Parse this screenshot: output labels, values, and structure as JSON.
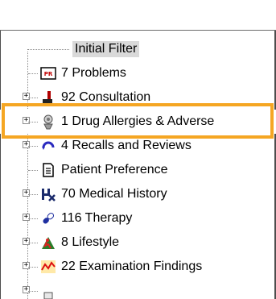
{
  "tree": {
    "root_label": "Initial Filter",
    "items": [
      {
        "label": "7 Problems",
        "icon": "problems-icon",
        "expandable": false
      },
      {
        "label": "92 Consultation",
        "icon": "consultation-icon",
        "expandable": true
      },
      {
        "label": "1 Drug Allergies & Adverse",
        "icon": "drug-allergy-icon",
        "expandable": true,
        "highlighted": true
      },
      {
        "label": "4 Recalls and Reviews",
        "icon": "recalls-icon",
        "expandable": true
      },
      {
        "label": "Patient Preference",
        "icon": "patient-preference-icon",
        "expandable": false
      },
      {
        "label": "70 Medical History",
        "icon": "medical-history-icon",
        "expandable": true
      },
      {
        "label": "116 Therapy",
        "icon": "therapy-icon",
        "expandable": true
      },
      {
        "label": "8 Lifestyle",
        "icon": "lifestyle-icon",
        "expandable": true
      },
      {
        "label": "22 Examination Findings",
        "icon": "examination-findings-icon",
        "expandable": true
      }
    ],
    "expander_symbol": "+"
  },
  "colors": {
    "highlight_border": "#f5a623",
    "selection_bg": "#d9d9d9"
  }
}
